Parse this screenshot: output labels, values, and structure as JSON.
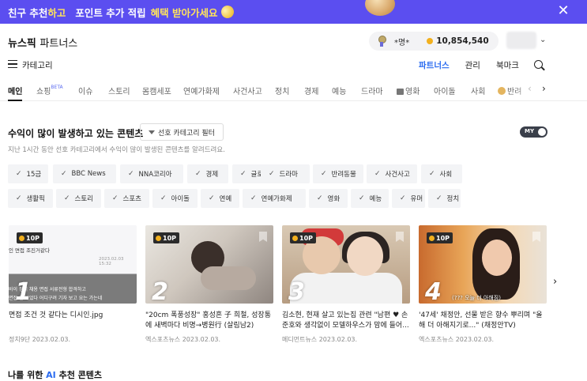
{
  "banner": {
    "part1": "친구 추천",
    "part2": "하고",
    "part3": "포인트 추가 적립",
    "part4": "혜택 받아가세요"
  },
  "header": {
    "brand": "뉴스픽",
    "brand_sub": "파트너스",
    "nickname": "*명*",
    "points": "10,854,540"
  },
  "subnav": {
    "category_label": "카테고리",
    "links": [
      "파트너스",
      "관리",
      "북마크"
    ]
  },
  "tabs": [
    {
      "label": "메인"
    },
    {
      "label": "쇼핑",
      "badge": "BETA"
    },
    {
      "label": "이슈"
    },
    {
      "label": "스토리"
    },
    {
      "label": "몸캠세포"
    },
    {
      "label": "연예가화제"
    },
    {
      "label": "사건사고"
    },
    {
      "label": "정치"
    },
    {
      "label": "경제"
    },
    {
      "label": "예능"
    },
    {
      "label": "드라마"
    },
    {
      "label": "영화"
    },
    {
      "label": "아이돌"
    },
    {
      "label": "사회"
    },
    {
      "label": "반려"
    }
  ],
  "section": {
    "title": "수익이 많이 발생하고 있는 콘텐츠",
    "filter_label": "선호 카테고리 필터",
    "toggle_label": "MY",
    "desc": "지난 1시간 동안 선호 카테고리에서 수익이 많이 발생된 콘텐츠를 알려드려요."
  },
  "chips_row1": [
    "15금",
    "BBC News",
    "NNA코리아",
    "경제",
    "글로벌",
    "드라마",
    "반려동물",
    "사건사고",
    "사회"
  ],
  "chips_row2": [
    "생활픽",
    "스토리",
    "스포츠",
    "아이돌",
    "연예",
    "연예가화제",
    "영화",
    "예능",
    "유머",
    "정치"
  ],
  "cards": [
    {
      "rank": "1",
      "badge": "10P",
      "title": "면접 조건 것 같다는 디시인.jpg",
      "meta": "정치9단 2023.02.03.",
      "thumb_text1": "면접 조건거같다",
      "thumb_text2": "인 면접 조진거같다",
      "thumb_date": "2023.02.03 15:32",
      "thumb_text3": "바이 정직 채용 면접 서류전형 합격하고",
      "thumb_text4": "면접 칠 되었다 어디구려 기자 보고 요는 가는네"
    },
    {
      "rank": "2",
      "badge": "10P",
      "title": "\"20cm 폭풍성장\" 홍성흔 子 희철, 성장통에 새벽마다 비명→병원行 (살림남2)",
      "meta": "엑스포츠뉴스 2023.02.03."
    },
    {
      "rank": "3",
      "badge": "10P",
      "title": "김소현, 현재 살고 있는집 관련 \"남편 ♥ 손준호와 생각없이 모델하우스가 맘에 들어...",
      "meta": "메디먼트뉴스 2023.02.03."
    },
    {
      "rank": "4",
      "badge": "10P",
      "title": "'47세' 채정안, 선물 받은 향수 뿌리며 \"올해 더 아해지기로...\" (채정안TV)",
      "meta": "엑스포츠뉴스 2023.02.03.",
      "thumb_sub": "(??? 오늘 더 아해짐)"
    }
  ],
  "next_section": {
    "prefix": "나를 위한",
    "ai": "AI",
    "suffix": "추천 콘텐츠"
  },
  "colors": {
    "banner": "#5b4ef0",
    "accent": "#2a6bf0",
    "highlight": "#ffe45c"
  }
}
